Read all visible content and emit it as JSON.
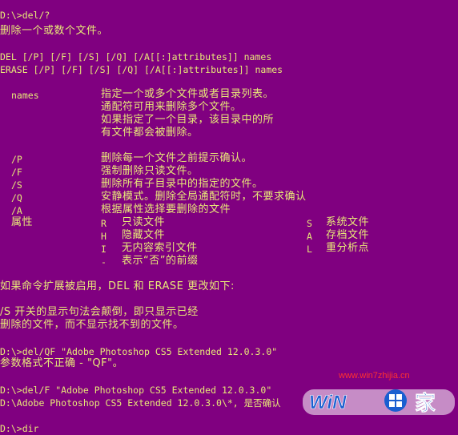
{
  "console": {
    "lines": {
      "l01": "D:\\>del/?",
      "l02": "删除一个或数个文件。",
      "l03": "DEL [/P] [/F] [/S] [/Q] [/A[[:]attributes]] names",
      "l04": "ERASE [/P] [/F] [/S] [/Q] [/A[[:]attributes]] names",
      "l05": "names",
      "l05b": "指定一个或多个文件或者目录列表。",
      "l06": "通配符可用来删除多个文件。",
      "l07": "如果指定了一个目录，该目录中的所",
      "l08": "有文件都会被删除。",
      "l09a": "/P",
      "l09b": "删除每一个文件之前提示确认。",
      "l10a": "/F",
      "l10b": "强制删除只读文件。",
      "l11a": "/S",
      "l11b": "删除所有子目录中的指定的文件。",
      "l12a": "/Q",
      "l12b": "安静模式。删除全局通配符时，不要求确认",
      "l13a": "/A",
      "l13b": "根据属性选择要删除的文件",
      "l14a": "属性",
      "l14b": "R",
      "l14c": "只读文件",
      "l14d": "S",
      "l14e": "系统文件",
      "l15b": "H",
      "l15c": "隐藏文件",
      "l15d": "A",
      "l15e": "存档文件",
      "l16b": "I",
      "l16c": "无内容索引文件",
      "l16d": "L",
      "l16e": "重分析点",
      "l17b": "-",
      "l17c": "表示“否”的前缀",
      "l18": "如果命令扩展被启用，DEL 和 ERASE 更改如下:",
      "l19": "/S 开关的显示句法会颠倒，即只显示已经",
      "l20": "删除的文件，而不显示找不到的文件。",
      "l21": "D:\\>del/QF \"Adobe Photoshop CS5 Extended 12.0.3.0\"",
      "l22": "参数格式不正确 - \"QF\"。",
      "l23": "D:\\>del/F \"Adobe Photoshop CS5 Extended 12.0.3.0\"",
      "l24": "D:\\Adobe Photoshop CS5 Extended 12.0.3.0\\*, 是否确认",
      "l25": "D:\\>dir"
    }
  },
  "watermark": {
    "url": "www.win7zhijia.cn",
    "brand_left": "WiN",
    "brand_right": "家",
    "colors": {
      "url": "#ff3030",
      "logo_blue": "#1a5fd0",
      "logo_white": "#ffffff"
    }
  },
  "colors": {
    "background": "#800080",
    "text": "#e8e878"
  }
}
